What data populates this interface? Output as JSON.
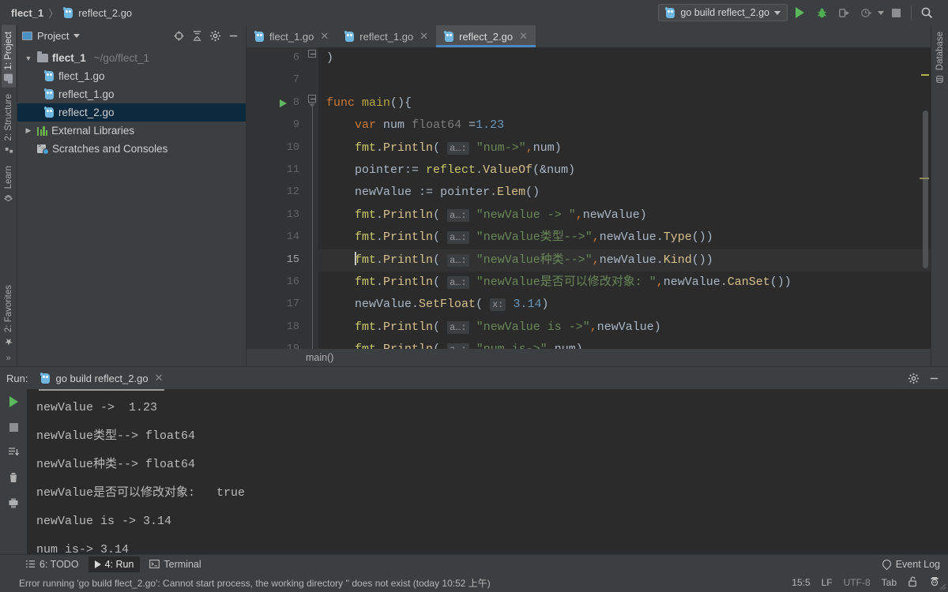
{
  "breadcrumb": {
    "project": "flect_1",
    "separator": "〉",
    "file": "reflect_2.go",
    "file_icon": "go-file-icon"
  },
  "toolbar": {
    "run_config": "go build reflect_2.go",
    "run_config_icon": "go-file-icon",
    "dropdown_icon": "chevron-down-icon",
    "run_icon": "run-play-icon",
    "debug_icon": "debug-bug-icon",
    "run_coverage_icon": "run-with-coverage-icon",
    "profile_icon": "profile-icon",
    "profile_caret_icon": "chevron-down-icon",
    "stop_icon": "stop-square-icon",
    "search_icon": "search-magnifier-icon"
  },
  "left_strip": {
    "tabs": [
      {
        "label": "1: Project",
        "icon": "project-folder-icon",
        "active": true
      },
      {
        "label": "2: Structure",
        "icon": "structure-icon",
        "active": false
      },
      {
        "label": "Learn",
        "icon": "learn-layers-icon",
        "active": false
      }
    ],
    "bottom_tabs": [
      {
        "label": "2: Favorites",
        "icon": "star-icon",
        "active": false
      }
    ],
    "expand_icon": "chevron-right-double-icon"
  },
  "right_strip": {
    "tabs": [
      {
        "label": "Database",
        "icon": "database-icon",
        "active": false
      }
    ]
  },
  "project_panel": {
    "title": "Project",
    "title_icon": "project-window-icon",
    "title_caret_icon": "chevron-down-icon",
    "actions": [
      {
        "name": "locate-target-icon",
        "label": ""
      },
      {
        "name": "collapse-all-icon",
        "label": ""
      },
      {
        "name": "gear-icon",
        "label": ""
      },
      {
        "name": "hide-minimize-icon",
        "label": ""
      }
    ],
    "tree": [
      {
        "label": "flect_1",
        "suffix": "~/go/flect_1",
        "icon": "folder-icon",
        "arrow": "▼",
        "depth": 0,
        "selected": false,
        "bold": true
      },
      {
        "label": "flect_1.go",
        "suffix": "",
        "icon": "go-file-icon",
        "arrow": "",
        "depth": 1,
        "selected": false,
        "bold": false
      },
      {
        "label": "reflect_1.go",
        "suffix": "",
        "icon": "go-file-icon",
        "arrow": "",
        "depth": 1,
        "selected": false,
        "bold": false
      },
      {
        "label": "reflect_2.go",
        "suffix": "",
        "icon": "go-file-icon",
        "arrow": "",
        "depth": 1,
        "selected": true,
        "bold": false
      },
      {
        "label": "External Libraries",
        "suffix": "",
        "icon": "libraries-icon",
        "arrow": "▶",
        "depth": 0,
        "selected": false,
        "bold": false
      },
      {
        "label": "Scratches and Consoles",
        "suffix": "",
        "icon": "scratches-icon",
        "arrow": "",
        "depth": 0,
        "selected": false,
        "bold": false
      }
    ]
  },
  "editor": {
    "tabs": [
      {
        "label": "flect_1.go",
        "icon": "go-file-icon",
        "close_icon": "close-x-icon",
        "active": false
      },
      {
        "label": "reflect_1.go",
        "icon": "go-file-icon",
        "close_icon": "close-x-icon",
        "active": false
      },
      {
        "label": "reflect_2.go",
        "icon": "go-file-icon",
        "close_icon": "close-x-icon",
        "active": true
      }
    ],
    "breadcrumb_bar": "main()",
    "first_visible_line": 6,
    "current_line": 15,
    "lines": [
      {
        "num": "6",
        "text": ")"
      },
      {
        "num": "7",
        "text": ""
      },
      {
        "num": "8",
        "text": "func main(){"
      },
      {
        "num": "9",
        "text": "    var num float64 =1.23"
      },
      {
        "num": "10",
        "text": "    fmt.Println( a…: \"num->\",num)"
      },
      {
        "num": "11",
        "text": "    pointer:= reflect.ValueOf(&num)"
      },
      {
        "num": "12",
        "text": "    newValue := pointer.Elem()"
      },
      {
        "num": "13",
        "text": "    fmt.Println( a…: \"newValue -> \",newValue)"
      },
      {
        "num": "14",
        "text": "    fmt.Println( a…: \"newValue类型-->\",newValue.Type())"
      },
      {
        "num": "15",
        "text": "    fmt.Println( a…: \"newValue种类-->\",newValue.Kind())"
      },
      {
        "num": "16",
        "text": "    fmt.Println( a…: \"newValue是否可以修改对象: \",newValue.CanSet())"
      },
      {
        "num": "17",
        "text": "    newValue.SetFloat( x: 3.14)"
      },
      {
        "num": "18",
        "text": "    fmt.Println( a…: \"newValue is ->\",newValue)"
      },
      {
        "num": "19",
        "text": "    fmt.Println( a…: \"num is->\",num)"
      }
    ],
    "param_hint_a": "a…:",
    "param_hint_x": "x:"
  },
  "run_panel": {
    "label": "Run:",
    "tab_label": "go build reflect_2.go",
    "tab_icon": "go-file-icon",
    "tab_close_icon": "close-x-icon",
    "gear_icon": "gear-icon",
    "minimize_icon": "hide-minimize-icon",
    "side_actions": [
      {
        "name": "rerun-play-icon"
      },
      {
        "name": "stop-square-icon"
      },
      {
        "name": "soft-wrap-icon"
      },
      {
        "name": "trash-icon"
      },
      {
        "name": "print-icon"
      }
    ],
    "output": [
      "newValue ->  1.23",
      "newValue类型--> float64",
      "newValue种类--> float64",
      "newValue是否可以修改对象:   true",
      "newValue is -> 3.14",
      "num is-> 3.14"
    ]
  },
  "tool_strip": {
    "buttons": [
      {
        "label": "6: TODO",
        "key": "6",
        "icon": "todo-list-icon",
        "active": false
      },
      {
        "label": "4: Run",
        "key": "4",
        "icon": "run-play-icon",
        "active": true
      },
      {
        "label": "Terminal",
        "key": "",
        "icon": "terminal-icon",
        "active": false
      }
    ],
    "event_log": {
      "label": "Event Log",
      "icon": "event-log-balloon-icon"
    }
  },
  "status_bar": {
    "message": "Error running 'go build flect_2.go': Cannot start process, the working directory '' does not exist (today 10:52 上午)",
    "caret_position": "15:5",
    "line_separator": "LF",
    "encoding": "UTF-8",
    "indent": "Tab",
    "lock_icon": "unlocked-padlock-icon",
    "inspector_icon": "hector-inspector-icon"
  },
  "colors": {
    "accent_blue": "#4a88c7",
    "selection_blue": "#0d293e",
    "editor_bg": "#2b2b2b",
    "chrome_bg": "#3c3f41",
    "gutter_bg": "#313335",
    "keyword_orange": "#cc7832",
    "string_green": "#6a8759",
    "number_blue": "#6897bb",
    "function_yellow": "#b5a642",
    "method_tan": "#d6c08c",
    "identifier": "#a9b7c6",
    "run_green": "#5cb85c"
  }
}
